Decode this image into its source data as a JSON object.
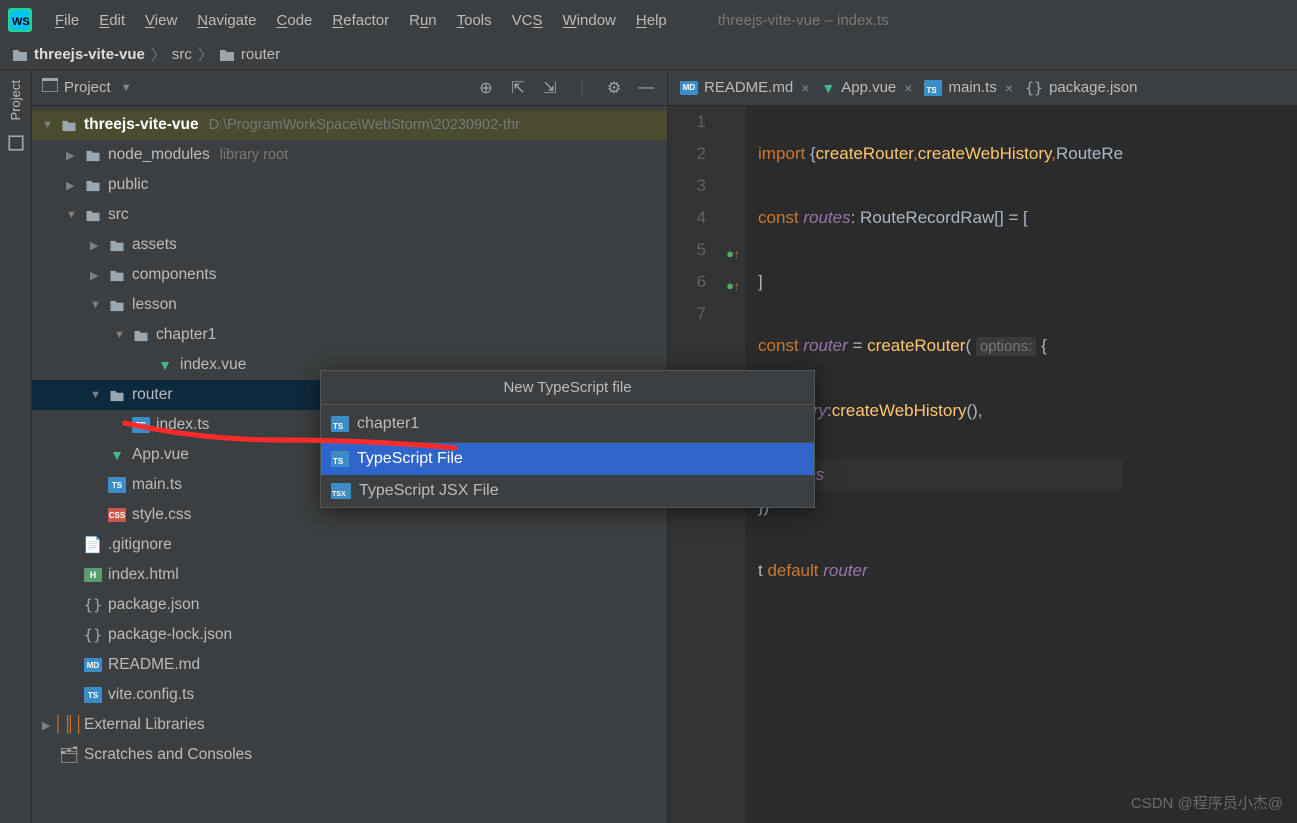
{
  "window": {
    "title": "threejs-vite-vue – index.ts"
  },
  "menus": [
    "File",
    "Edit",
    "View",
    "Navigate",
    "Code",
    "Refactor",
    "Run",
    "Tools",
    "VCS",
    "Window",
    "Help"
  ],
  "breadcrumb": {
    "project": "threejs-vite-vue",
    "path1": "src",
    "path2": "router"
  },
  "sidebar": {
    "title": "Project",
    "project_name": "threejs-vite-vue",
    "project_path": "D:\\ProgramWorkSpace\\WebStorm\\20230902-thr",
    "node_modules": "node_modules",
    "node_modules_hint": "library root",
    "public": "public",
    "src": "src",
    "assets": "assets",
    "components": "components",
    "lesson": "lesson",
    "chapter1": "chapter1",
    "chapter1_index": "index.vue",
    "router": "router",
    "router_index": "index.ts",
    "app_vue": "App.vue",
    "main_ts": "main.ts",
    "style_css": "style.css",
    "gitignore": ".gitignore",
    "index_html": "index.html",
    "package_json": "package.json",
    "package_lock": "package-lock.json",
    "readme": "README.md",
    "vite_config": "vite.config.ts",
    "ext_lib": "External Libraries",
    "scratches": "Scratches and Consoles"
  },
  "tabs": {
    "readme": "README.md",
    "app": "App.vue",
    "main": "main.ts",
    "pkg": "package.json"
  },
  "code": {
    "l1a": "import ",
    "l1b": "{",
    "l1c": "createRouter",
    "l1d": ",",
    "l1e": "createWebHistory",
    "l1f": ",",
    "l1g": "RouteRe",
    "l2a": "const ",
    "l2b": "routes",
    "l2c": ": RouteRecordRaw[] = [",
    "l3": "]",
    "l4a": "const ",
    "l4b": "router",
    "l4c": " = ",
    "l4d": "createRouter",
    "l4e": "( ",
    "l4hint": "options:",
    "l4f": " {",
    "l5a": "    history",
    "l5b": ":",
    "l5c": "createWebHistory",
    "l5d": "(),",
    "l6": "    routes",
    "l7": "})",
    "l8a": "t ",
    "l8b": "default ",
    "l8c": "router"
  },
  "popup": {
    "title": "New TypeScript file",
    "input": "chapter1",
    "opt1": "TypeScript File",
    "opt2": "TypeScript JSX File"
  },
  "gutter_label": "Project",
  "watermark": "CSDN @程序员小杰@"
}
